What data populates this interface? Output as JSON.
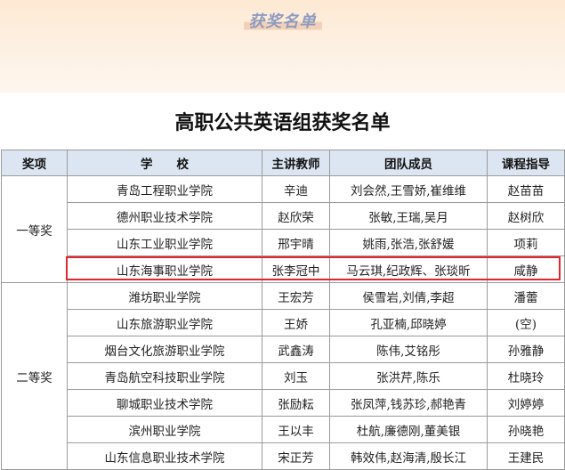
{
  "banner": {
    "title": "获奖名单"
  },
  "document": {
    "title": "高职公共英语组获奖名单"
  },
  "table": {
    "headers": [
      "奖项",
      "学　　校",
      "主讲教师",
      "团队成员",
      "课程指导"
    ],
    "groups": [
      {
        "award": "一等奖",
        "rows": [
          {
            "school": "青岛工程职业学院",
            "teacher": "辛迪",
            "team": "刘会然,王雪娇,崔维维",
            "advisor": "赵苗苗"
          },
          {
            "school": "德州职业技术学院",
            "teacher": "赵欣荣",
            "team": "张敏,王瑞,吴月",
            "advisor": "赵树欣"
          },
          {
            "school": "山东工业职业学院",
            "teacher": "邢宇晴",
            "team": "姚雨,张浩,张舒媛",
            "advisor": "项莉"
          },
          {
            "school": "山东海事职业学院",
            "teacher": "张李冠中",
            "team": "马云琪,纪政辉、张琰昕",
            "advisor": "咸静"
          }
        ]
      },
      {
        "award": "二等奖",
        "rows": [
          {
            "school": "潍坊职业学院",
            "teacher": "王宏芳",
            "team": "侯雪岩,刘倩,李超",
            "advisor": "潘蕾"
          },
          {
            "school": "山东旅游职业学院",
            "teacher": "王娇",
            "team": "孔亚楠,邱晓婷",
            "advisor": "(空)"
          },
          {
            "school": "烟台文化旅游职业学院",
            "teacher": "武鑫涛",
            "team": "陈伟,艾铭彤",
            "advisor": "孙雅静"
          },
          {
            "school": "青岛航空科技职业学院",
            "teacher": "刘玉",
            "team": "张洪芹,陈乐",
            "advisor": "杜晓玲"
          },
          {
            "school": "聊城职业技术学院",
            "teacher": "张励耘",
            "team": "张凤萍,钱苏珍,郝艳青",
            "advisor": "刘婷婷"
          },
          {
            "school": "滨州职业学院",
            "teacher": "王以丰",
            "team": "杜航,廉德刚,董美银",
            "advisor": "孙晓艳"
          },
          {
            "school": "山东信息职业技术学院",
            "teacher": "宋正芳",
            "team": "韩效伟,赵海清,殷长江",
            "advisor": "王建民"
          }
        ]
      }
    ]
  }
}
